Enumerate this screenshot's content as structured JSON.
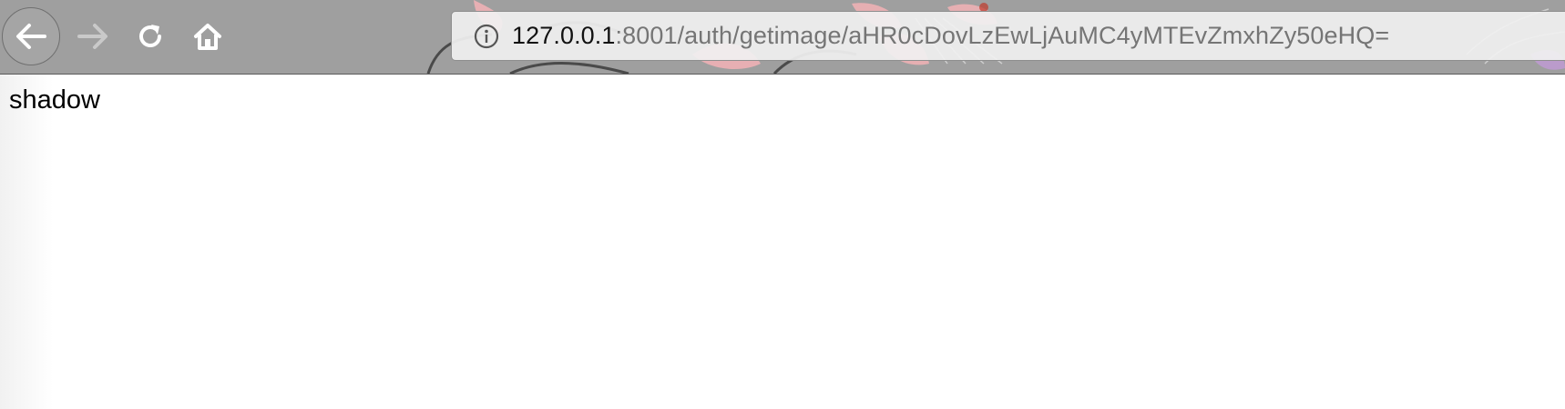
{
  "browser": {
    "nav": {
      "back_icon": "back-arrow-icon",
      "forward_icon": "forward-arrow-icon",
      "reload_icon": "reload-icon",
      "home_icon": "home-icon"
    },
    "urlbar": {
      "info_icon": "info-icon",
      "host": "127.0.0.1",
      "path": ":8001/auth/getimage/aHR0cDovLzEwLjAuMC4yMTEvZmxhZy50eHQ="
    },
    "theme": {
      "toolbar_color": "#9f9f9f",
      "accent_pink": "#f0a0a8"
    }
  },
  "page": {
    "body_text": "shadow"
  }
}
